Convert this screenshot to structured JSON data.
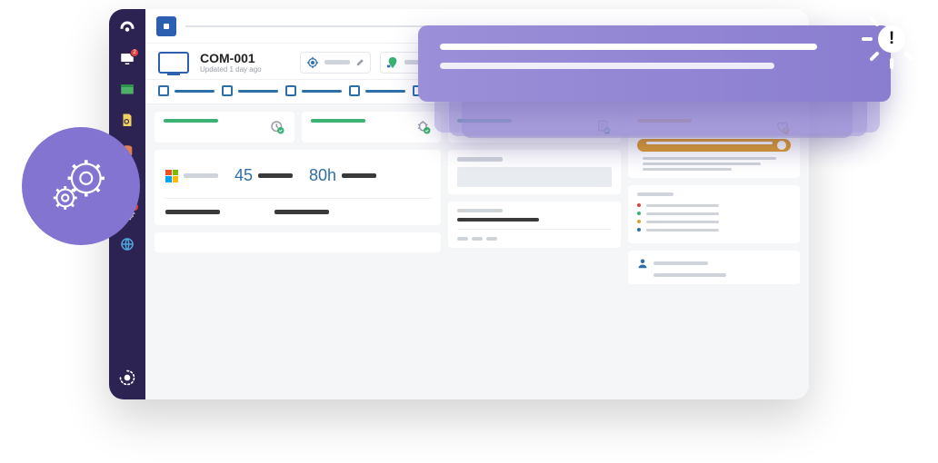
{
  "colors": {
    "sidebar": "#2d2352",
    "accent": "#2d6fa8",
    "purple": "#9b8fd8",
    "green": "#3bb273",
    "warn": "#e0a030"
  },
  "sidebar": {
    "items": [
      {
        "name": "dashboard-icon"
      },
      {
        "name": "monitor-icon",
        "badge": "2"
      },
      {
        "name": "apps-icon"
      },
      {
        "name": "compliance-icon"
      },
      {
        "name": "database-icon"
      },
      {
        "name": "package-icon"
      },
      {
        "name": "settings-icon",
        "badge": "1"
      },
      {
        "name": "globe-icon"
      }
    ]
  },
  "asset": {
    "title": "COM-001",
    "subtitle": "Updated 1 day ago",
    "tags": [
      {
        "icon": "target-icon"
      },
      {
        "icon": "map-pin-icon"
      }
    ]
  },
  "tabs": [
    {
      "active": true
    },
    {
      "active": true
    },
    {
      "active": true
    },
    {
      "active": true
    },
    {
      "active": true
    },
    {
      "active": false
    }
  ],
  "status_cards": [
    {
      "color": "green",
      "icon": "clock-check-icon"
    },
    {
      "color": "green",
      "icon": "bug-check-icon"
    },
    {
      "color": "green",
      "icon": "doc-check-icon"
    },
    {
      "color": "warn",
      "icon": "heart-warn-icon"
    }
  ],
  "metrics": {
    "os_icon": "windows-icon",
    "value1": "45",
    "value2": "80h"
  },
  "list_colors": [
    "#e04040",
    "#3bb273",
    "#e0a030",
    "#2d6fa8"
  ]
}
